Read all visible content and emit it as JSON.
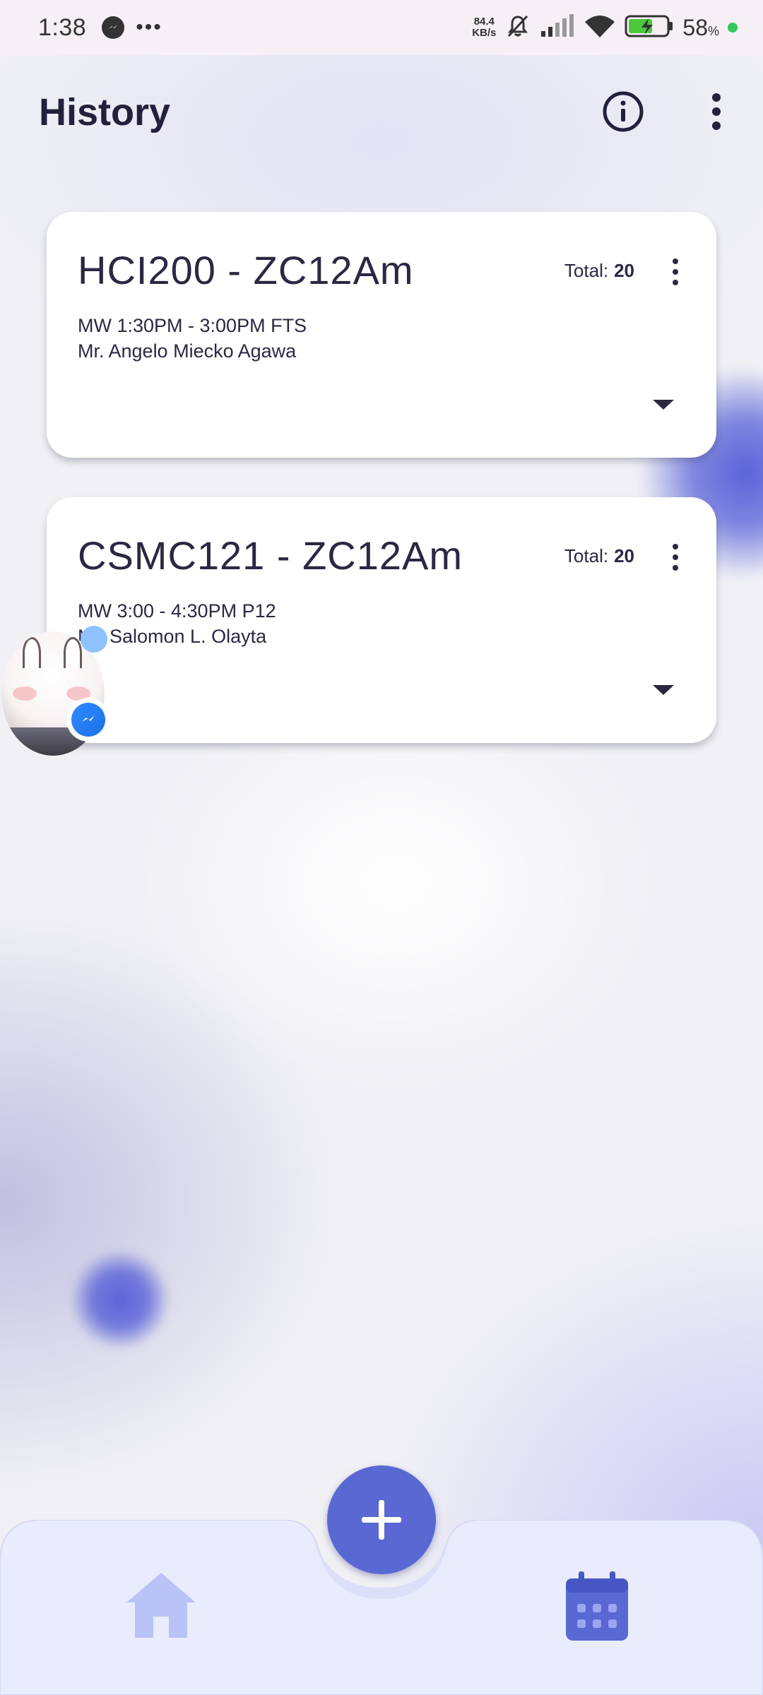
{
  "status_bar": {
    "time": "1:38",
    "net_speed_value": "84.4",
    "net_speed_unit": "KB/s",
    "battery_percent": "58",
    "battery_unit": "%"
  },
  "header": {
    "title": "History"
  },
  "cards": [
    {
      "title": "HCI200 - ZC12Am",
      "total_label": "Total:",
      "total_value": "20",
      "schedule": "MW 1:30PM - 3:00PM FTS",
      "instructor": "Mr. Angelo Miecko Agawa"
    },
    {
      "title": "CSMC121 - ZC12Am",
      "total_label": "Total:",
      "total_value": "20",
      "schedule": "MW 3:00 - 4:30PM P12",
      "instructor": "Mr. Salomon L. Olayta"
    }
  ],
  "icons": {
    "info": "info-icon",
    "overflow_menu": "more-vertical-icon",
    "expand": "caret-down-icon",
    "add": "plus-icon",
    "home": "home-icon",
    "calendar": "calendar-icon",
    "messenger": "messenger-icon"
  },
  "colors": {
    "accent": "#5a68d4",
    "title_text": "#22203a",
    "card_bg": "#ffffff",
    "nav_bg": "#e9ecfc"
  }
}
